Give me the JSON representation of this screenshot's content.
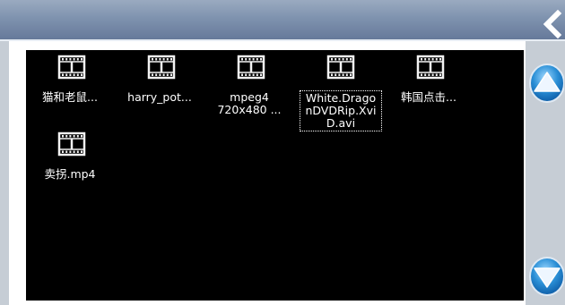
{
  "header": {
    "back_icon": "chevron-left-icon"
  },
  "files": [
    {
      "name": "猫和老鼠...",
      "icon": "film-icon",
      "selected": false
    },
    {
      "name": "harry_pot...",
      "icon": "film-icon",
      "selected": false
    },
    {
      "name": "mpeg4\n720x480 ...",
      "icon": "film-icon",
      "selected": false
    },
    {
      "name": "White.Drago\nnDVDRip.Xvi\nD.avi",
      "icon": "film-icon",
      "selected": true
    },
    {
      "name": "韩国点击...",
      "icon": "film-icon",
      "selected": false
    },
    {
      "name": "卖拐.mp4",
      "icon": "film-icon",
      "selected": false
    }
  ],
  "scroll": {
    "up_icon": "arrow-up-icon",
    "down_icon": "arrow-down-icon"
  },
  "colors": {
    "accent": "#2a8fd6",
    "header": "#7f93af",
    "pane": "#000000",
    "icon": "#f2f2f2"
  }
}
